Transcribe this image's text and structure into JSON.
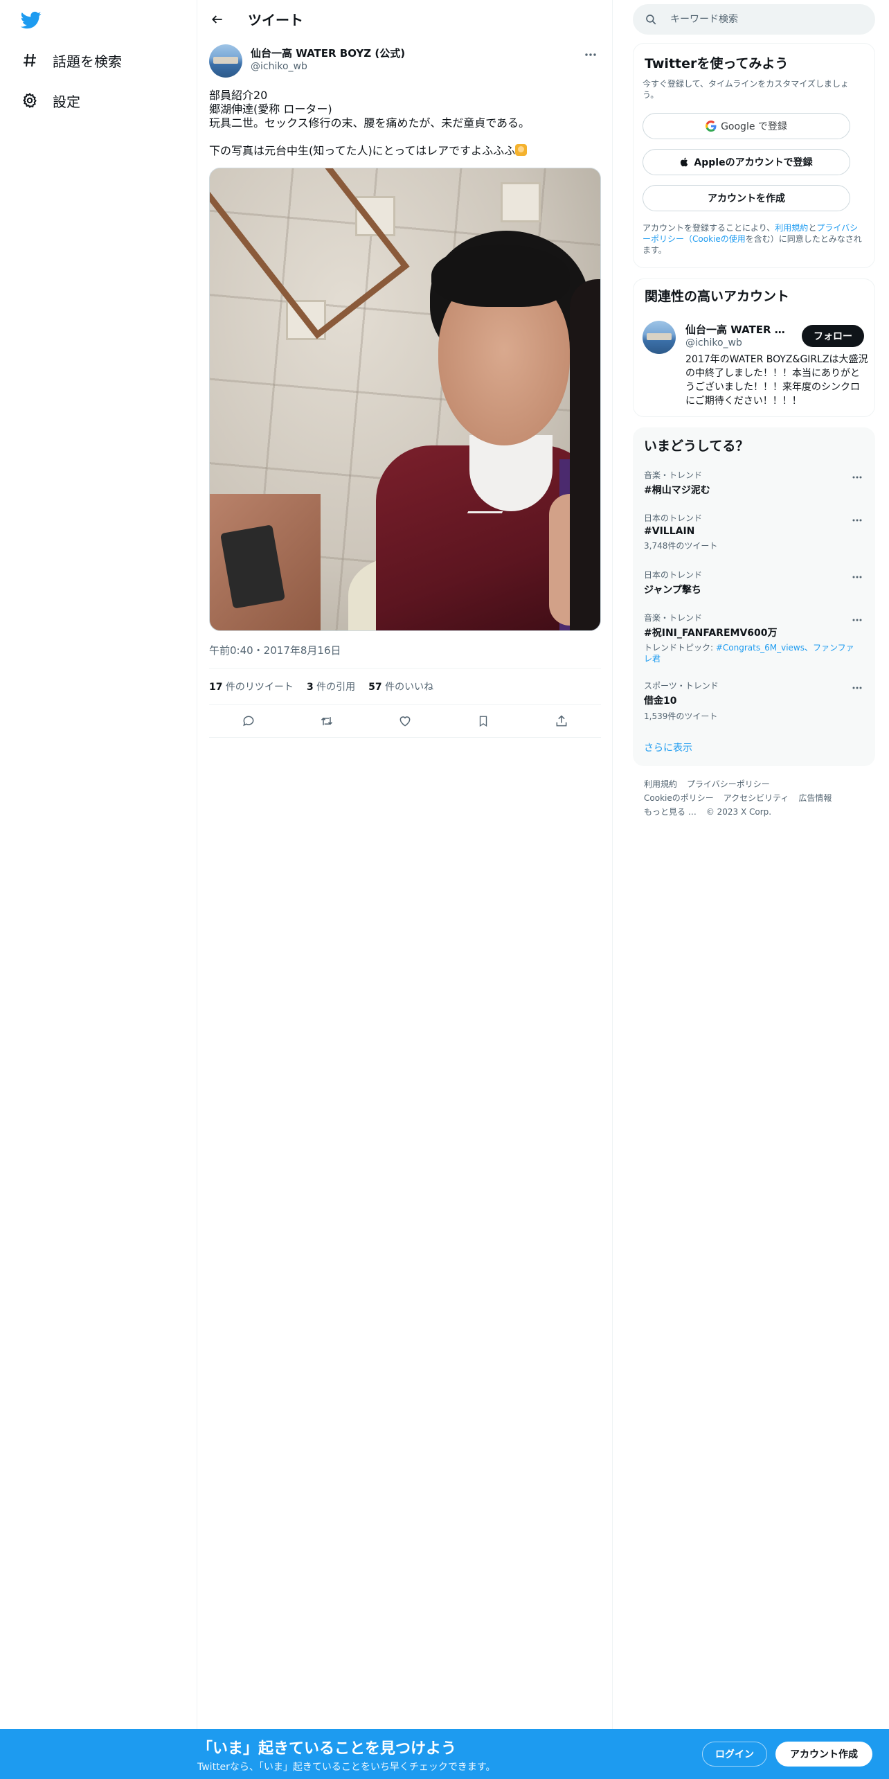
{
  "colors": {
    "accent": "#1d9bf0",
    "text": "#0f1419",
    "muted": "#536471",
    "border": "#eff3f4"
  },
  "nav": {
    "logo_icon": "twitter-bird-icon",
    "items": [
      {
        "label": "話題を検索",
        "icon": "hashtag-icon"
      },
      {
        "label": "設定",
        "icon": "gear-icon"
      }
    ]
  },
  "main": {
    "title": "ツイート",
    "tweet": {
      "author_name": "仙台一高 WATER BOYZ (公式)",
      "author_handle": "@ichiko_wb",
      "text_lines_1": "部員紹介20\n郷湖伸達(愛称 ローター)\n玩具二世。セックス修行の末、腰を痛めたが、未だ童貞である。",
      "text_line_2": "下の写真は元台中生(知ってた人)にとってはレアですよふふふ",
      "timestamp": "午前0:40・2017年8月16日",
      "stats": {
        "retweets_count": "17",
        "retweets_label": "件のリツイート",
        "quotes_count": "3",
        "quotes_label": "件の引用",
        "likes_count": "57",
        "likes_label": "件のいいね"
      }
    }
  },
  "right": {
    "search_placeholder": "キーワード検索",
    "signup": {
      "title": "Twitterを使ってみよう",
      "subtitle": "今すぐ登録して、タイムラインをカスタマイズしましょう。",
      "google_label": "Google で登録",
      "apple_label": "Appleのアカウントで登録",
      "create_label": "アカウントを作成",
      "legal_prefix": "アカウントを登録することにより、",
      "legal_terms": "利用規約",
      "legal_and": "と",
      "legal_privacy": "プライバシーポリシー（Cookieの使用",
      "legal_suffix": "を含む）に同意したとみなされます。"
    },
    "related": {
      "title": "関連性の高いアカウント",
      "name": "仙台一高 WATER BOYZ (公式)",
      "handle": "@ichiko_wb",
      "follow_label": "フォロー",
      "bio": "2017年のWATER BOYZ&GIRLZは大盛況の中終了しました！！！本当にありがとうございました！！！来年度のシンクロにご期待ください！！！！"
    },
    "trends": {
      "title": "いまどうしてる？",
      "items": [
        {
          "category": "音楽・トレンド",
          "name": "#桐山マジ泥む",
          "count": ""
        },
        {
          "category": "日本のトレンド",
          "name": "#VILLAIN",
          "count": "3,748件のツイート"
        },
        {
          "category": "日本のトレンド",
          "name": "ジャンプ撃ち",
          "count": ""
        },
        {
          "category": "音楽・トレンド",
          "name": "#祝INI_FANFAREMV600万",
          "topic_prefix": "トレンドトピック: ",
          "topic_links": "#Congrats_6M_views、ファンファレ君"
        },
        {
          "category": "スポーツ・トレンド",
          "name": "借金10",
          "count": "1,539件のツイート"
        }
      ],
      "show_more": "さらに表示"
    },
    "footer": {
      "links": [
        "利用規約",
        "プライバシーポリシー",
        "Cookieのポリシー",
        "アクセシビリティ",
        "広告情報",
        "もっと見る …",
        "© 2023 X Corp."
      ]
    }
  },
  "bottom_bar": {
    "title": "「いま」起きていることを見つけよう",
    "subtitle": "Twitterなら、「いま」起きていることをいち早くチェックできます。",
    "login_label": "ログイン",
    "signup_label": "アカウント作成"
  }
}
